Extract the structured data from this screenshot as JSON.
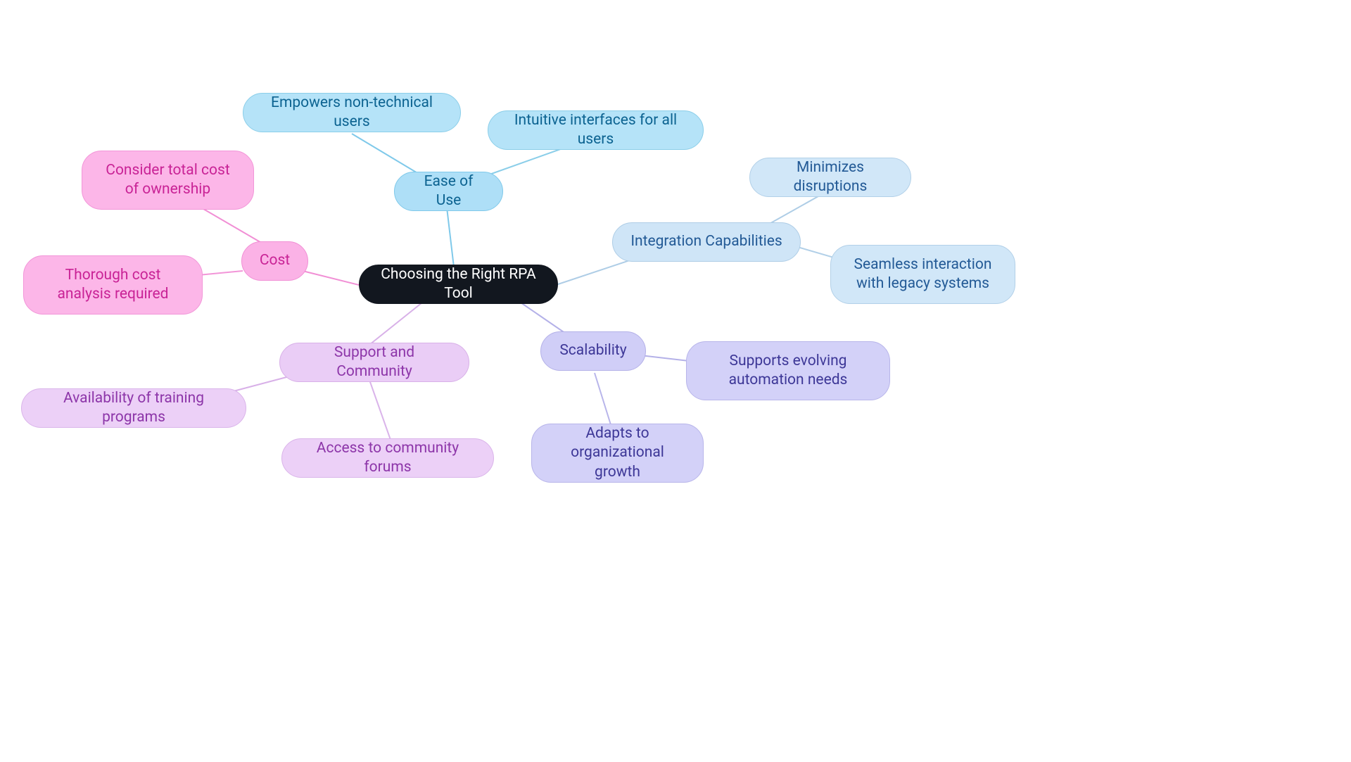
{
  "center": {
    "label": "Choosing the Right RPA Tool"
  },
  "ease": {
    "label": "Ease of Use",
    "sub1": "Empowers non-technical users",
    "sub2": "Intuitive interfaces for all users"
  },
  "integration": {
    "label": "Integration Capabilities",
    "sub1": "Minimizes disruptions",
    "sub2": "Seamless interaction with legacy systems"
  },
  "scalability": {
    "label": "Scalability",
    "sub1": "Supports evolving automation needs",
    "sub2": "Adapts to organizational growth"
  },
  "support": {
    "label": "Support and Community",
    "sub1": "Availability of training programs",
    "sub2": "Access to community forums"
  },
  "cost": {
    "label": "Cost",
    "sub1": "Consider total cost of ownership",
    "sub2": "Thorough cost analysis required"
  },
  "colors": {
    "center": "#12171f",
    "ease": "#7fc9ea",
    "integration": "#aecde6",
    "scalability": "#b4b1e8",
    "support": "#d8b0e8",
    "cost": "#f18fd5"
  }
}
